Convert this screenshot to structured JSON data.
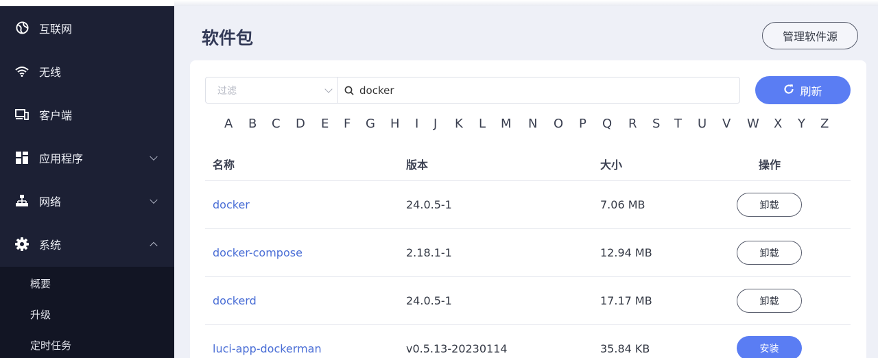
{
  "sidebar": {
    "items": [
      {
        "label": "互联网",
        "icon": "globe-icon"
      },
      {
        "label": "无线",
        "icon": "wifi-icon"
      },
      {
        "label": "客户端",
        "icon": "devices-icon"
      },
      {
        "label": "应用程序",
        "icon": "apps-icon",
        "expandable": true
      },
      {
        "label": "网络",
        "icon": "network-icon",
        "expandable": true
      },
      {
        "label": "系统",
        "icon": "gear-icon",
        "expandable": true,
        "expanded": true
      }
    ],
    "submenu": [
      "概要",
      "升级",
      "定时任务"
    ]
  },
  "header": {
    "title": "软件包",
    "manage_sources_label": "管理软件源"
  },
  "toolbar": {
    "filter_placeholder": "过滤",
    "search_value": "docker",
    "refresh_label": "刷新"
  },
  "alphabet": [
    "A",
    "B",
    "C",
    "D",
    "E",
    "F",
    "G",
    "H",
    "I",
    "J",
    "K",
    "L",
    "M",
    "N",
    "O",
    "P",
    "Q",
    "R",
    "S",
    "T",
    "U",
    "V",
    "W",
    "X",
    "Y",
    "Z"
  ],
  "table": {
    "columns": [
      "名称",
      "版本",
      "大小",
      "操作"
    ],
    "rows": [
      {
        "name": "docker",
        "version": "24.0.5-1",
        "size": "7.06 MB",
        "action": "卸载",
        "installed": true
      },
      {
        "name": "docker-compose",
        "version": "2.18.1-1",
        "size": "12.94 MB",
        "action": "卸载",
        "installed": true
      },
      {
        "name": "dockerd",
        "version": "24.0.5-1",
        "size": "17.17 MB",
        "action": "卸载",
        "installed": true
      },
      {
        "name": "luci-app-dockerman",
        "version": "v0.5.13-20230114",
        "size": "35.84 KB",
        "action": "安装",
        "installed": false
      }
    ]
  },
  "colors": {
    "sidebar_bg": "#1c2034",
    "submenu_bg": "#121524",
    "accent": "#5a7df3",
    "link": "#4a6ed6"
  }
}
